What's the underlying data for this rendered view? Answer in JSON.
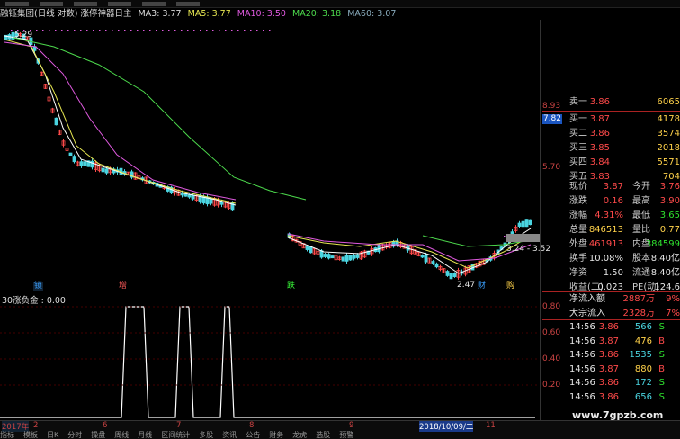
{
  "legend": {
    "title": "融钰集团(日线 对数) 涨停神器日主",
    "ma3": "MA3: 3.77",
    "ma5": "MA5: 3.77",
    "ma10": "MA10: 3.50",
    "ma20": "MA20: 3.18",
    "ma60": "MA60: 3.07"
  },
  "price_axis": {
    "top": "8.93",
    "mid": "5.70",
    "current": "7.82"
  },
  "annotations": {
    "high": "5.29",
    "low": "2.47",
    "range": "3.24 - 3.52"
  },
  "event_markers": [
    {
      "label": "锁",
      "color": "#3aa0ff"
    },
    {
      "label": "增",
      "color": "#ff5a5a"
    },
    {
      "label": "跌",
      "color": "#3aff3a"
    },
    {
      "label": "财",
      "color": "#3aa0ff"
    },
    {
      "label": "购",
      "color": "#ffd24a"
    }
  ],
  "indicator": {
    "title": "30涨负金 : 0.00",
    "ticks": [
      "0.80",
      "0.60",
      "0.40",
      "0.20"
    ],
    "values": [
      0,
      0,
      0,
      0,
      0,
      0,
      0,
      0,
      0,
      0,
      0,
      0,
      0,
      0,
      0,
      0,
      0,
      0,
      0,
      0,
      0,
      0,
      0,
      0,
      0,
      0,
      0,
      0,
      1,
      1,
      1,
      1,
      1,
      0,
      0,
      0,
      0,
      0,
      0,
      0,
      1,
      1,
      1,
      0,
      0,
      0,
      0,
      0,
      0,
      0,
      1,
      1,
      0,
      0,
      0,
      0,
      0,
      0,
      0,
      0,
      0,
      0,
      0,
      0,
      0,
      0,
      0,
      0,
      0,
      0,
      0,
      0,
      0,
      0,
      0,
      0,
      0,
      0,
      0,
      0,
      0,
      0,
      0,
      0,
      0,
      0,
      0,
      0,
      0,
      0,
      0,
      0,
      0,
      0,
      0,
      0,
      0,
      0,
      0,
      0,
      0,
      0,
      0,
      0,
      0,
      0,
      0,
      0,
      0,
      0,
      0,
      0,
      0,
      0,
      0,
      0,
      0,
      0,
      0,
      0
    ]
  },
  "dates": [
    "2017年",
    "2",
    "6",
    "7",
    "8",
    "9",
    "2018/10/09/二",
    "11"
  ],
  "tabs": [
    "指标",
    "模板",
    "日K",
    "分时",
    "操盘",
    "周线",
    "月线",
    "区间统计",
    "多股",
    "资讯",
    "公告",
    "财务",
    "龙虎",
    "选股",
    "预警"
  ],
  "quote_book": {
    "sell": [
      {
        "label": "卖一",
        "price": "3.86",
        "vol": "6065"
      }
    ],
    "buy": [
      {
        "label": "买一",
        "price": "3.87",
        "vol": "4178"
      },
      {
        "label": "买二",
        "price": "3.86",
        "vol": "3574"
      },
      {
        "label": "买三",
        "price": "3.85",
        "vol": "2018"
      },
      {
        "label": "买四",
        "price": "3.84",
        "vol": "5571"
      },
      {
        "label": "买五",
        "price": "3.83",
        "vol": "704"
      }
    ]
  },
  "stats": [
    {
      "l1": "现价",
      "v1": "3.87",
      "c1": "red",
      "l2": "今开",
      "v2": "3.76",
      "c2": "red"
    },
    {
      "l1": "涨跌",
      "v1": "0.16",
      "c1": "red",
      "l2": "最高",
      "v2": "3.90",
      "c2": "red"
    },
    {
      "l1": "涨幅",
      "v1": "4.31%",
      "c1": "red",
      "l2": "最低",
      "v2": "3.65",
      "c2": "grn"
    },
    {
      "l1": "总量",
      "v1": "846513",
      "c1": "yel",
      "l2": "量比",
      "v2": "0.77",
      "c2": "yel"
    },
    {
      "l1": "外盘",
      "v1": "461913",
      "c1": "red",
      "l2": "内盘",
      "v2": "384599",
      "c2": "grn"
    },
    {
      "l1": "换手",
      "v1": "10.08%",
      "c1": "wht",
      "l2": "股本",
      "v2": "8.40亿",
      "c2": "wht"
    },
    {
      "l1": "净资",
      "v1": "1.50",
      "c1": "wht",
      "l2": "流通",
      "v2": "8.40亿",
      "c2": "wht"
    },
    {
      "l1": "收益(二)",
      "v1": "0.023",
      "c1": "wht",
      "l2": "PE(动)",
      "v2": "124.6",
      "c2": "wht"
    }
  ],
  "flow": [
    {
      "label": "净流入额",
      "value": "2887万",
      "pct": "9%"
    },
    {
      "label": "大宗流入",
      "value": "2328万",
      "pct": "7%"
    }
  ],
  "ticks": [
    {
      "time": "14:56",
      "price": "3.86",
      "vol": "566",
      "side": "S"
    },
    {
      "time": "14:56",
      "price": "3.87",
      "vol": "476",
      "side": "B"
    },
    {
      "time": "14:56",
      "price": "3.86",
      "vol": "1535",
      "side": "S"
    },
    {
      "time": "14:56",
      "price": "3.87",
      "vol": "880",
      "side": "B"
    },
    {
      "time": "14:56",
      "price": "3.86",
      "vol": "172",
      "side": "S"
    },
    {
      "time": "14:56",
      "price": "3.86",
      "vol": "656",
      "side": "S"
    }
  ],
  "watermark": "www.7gpzb.com",
  "colors": {
    "up": "#ff4a4a",
    "down": "#4ad4e0",
    "ma3": "#ffffff",
    "ma5": "#e7e751",
    "ma10": "#e05ae0",
    "ma20": "#4cd84c"
  }
}
